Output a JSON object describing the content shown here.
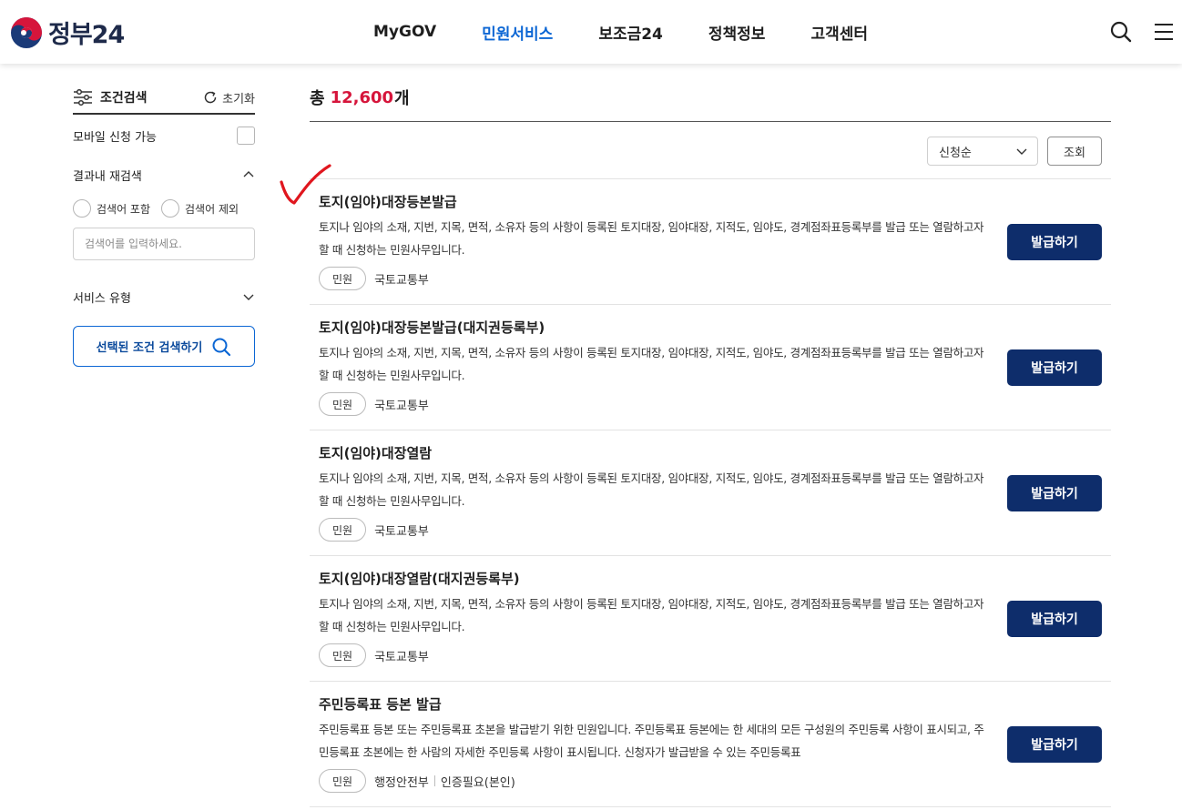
{
  "header": {
    "logo_text": "정부24",
    "nav": [
      "MyGOV",
      "민원서비스",
      "보조금24",
      "정책정보",
      "고객센터"
    ],
    "active_nav": "민원서비스",
    "accent_color": "#0b66d4"
  },
  "sidebar": {
    "title": "조건검색",
    "reset_label": "초기화",
    "mobile_label": "모바일 신청 가능",
    "mobile_checked": false,
    "research_label": "결과내 재검색",
    "radio_include": "검색어 포함",
    "radio_exclude": "검색어 제외",
    "input_placeholder": "검색어를 입력하세요.",
    "service_type_label": "서비스 유형",
    "search_button": "선택된 조건 검색하기"
  },
  "main": {
    "total_prefix": "총",
    "total_count": "12,600",
    "total_suffix": "개",
    "sort_selected": "신청순",
    "query_button": "조회",
    "issue_color": "#0e2d6b",
    "items": [
      {
        "title": "토지(임야)대장등본발급",
        "desc": "토지나 임야의 소재, 지번, 지목, 면적, 소유자 등의 사항이 등록된 토지대장, 임야대장, 지적도, 임야도, 경계점좌표등록부를 발급 또는 열람하고자 할 때 신청하는 민원사무입니다.",
        "tag": "민원",
        "dept": "국토교통부",
        "extra": "",
        "button": "발급하기"
      },
      {
        "title": "토지(임야)대장등본발급(대지권등록부)",
        "desc": "토지나 임야의 소재, 지번, 지목, 면적, 소유자 등의 사항이 등록된 토지대장, 임야대장, 지적도, 임야도, 경계점좌표등록부를 발급 또는 열람하고자 할 때 신청하는 민원사무입니다.",
        "tag": "민원",
        "dept": "국토교통부",
        "extra": "",
        "button": "발급하기"
      },
      {
        "title": "토지(임야)대장열람",
        "desc": "토지나 임야의 소재, 지번, 지목, 면적, 소유자 등의 사항이 등록된 토지대장, 임야대장, 지적도, 임야도, 경계점좌표등록부를 발급 또는 열람하고자 할 때 신청하는 민원사무입니다.",
        "tag": "민원",
        "dept": "국토교통부",
        "extra": "",
        "button": "발급하기"
      },
      {
        "title": "토지(임야)대장열람(대지권등록부)",
        "desc": "토지나 임야의 소재, 지번, 지목, 면적, 소유자 등의 사항이 등록된 토지대장, 임야대장, 지적도, 임야도, 경계점좌표등록부를 발급 또는 열람하고자 할 때 신청하는 민원사무입니다.",
        "tag": "민원",
        "dept": "국토교통부",
        "extra": "",
        "button": "발급하기"
      },
      {
        "title": "주민등록표 등본 발급",
        "desc": "주민등록표 등본 또는 주민등록표 초본을 발급받기 위한 민원입니다. 주민등록표 등본에는 한 세대의 모든 구성원의 주민등록 사항이 표시되고, 주민등록표 초본에는 한 사람의 자세한 주민등록 사항이 표시됩니다. 신청자가 발급받을 수 있는 주민등록표",
        "tag": "민원",
        "dept": "행정안전부",
        "extra": "인증필요(본인)",
        "button": "발급하기"
      }
    ]
  }
}
